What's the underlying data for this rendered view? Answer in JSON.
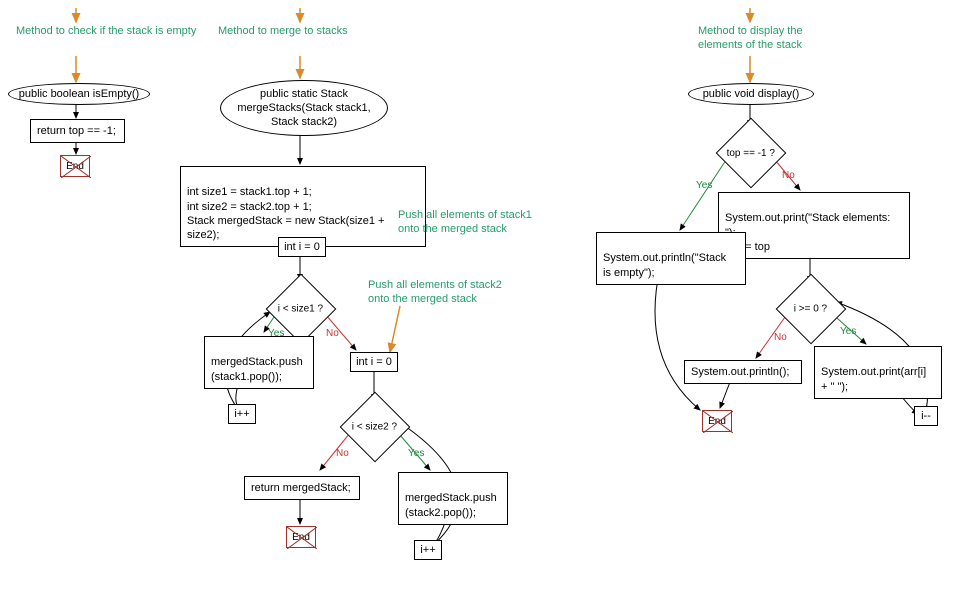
{
  "flowchart1": {
    "title": "Method to check if\nthe stack is empty",
    "start": "public boolean isEmpty()",
    "body": "return top == -1;",
    "end": "End"
  },
  "flowchart2": {
    "title": "Method to merge to stacks",
    "start": "public static Stack\nmergeStacks(Stack stack1,\nStack stack2)",
    "init": "int size1 = stack1.top + 1;\nint size2 = stack2.top + 1;\nStack mergedStack = new Stack(size1 + size2);",
    "annotation1": "Push all elements of stack1\nonto the merged stack",
    "loop1_init": "int i = 0",
    "loop1_cond": "i < size1 ?",
    "loop1_body": "mergedStack.push\n(stack1.pop());",
    "loop1_inc": "i++",
    "annotation2": "Push all elements of stack2\nonto the merged stack",
    "loop2_init": "int i = 0",
    "loop2_cond": "i < size2 ?",
    "loop2_body": "mergedStack.push\n(stack2.pop());",
    "loop2_inc": "i++",
    "return": "return mergedStack;",
    "end": "End",
    "yes": "Yes",
    "no": "No"
  },
  "flowchart3": {
    "title": "Method to display the\nelements of the stack",
    "start": "public void display()",
    "cond": "top == -1 ?",
    "empty_branch": "System.out.println(\"Stack\nis empty\");",
    "nonempty_init": "System.out.print(\"Stack elements: \");\nint i = top",
    "loop_cond": "i >= 0 ?",
    "loop_body": "System.out.print(arr[i]\n+ \" \");",
    "loop_inc": "i--",
    "after_loop": "System.out.println();",
    "end": "End",
    "yes": "Yes",
    "no": "No"
  }
}
